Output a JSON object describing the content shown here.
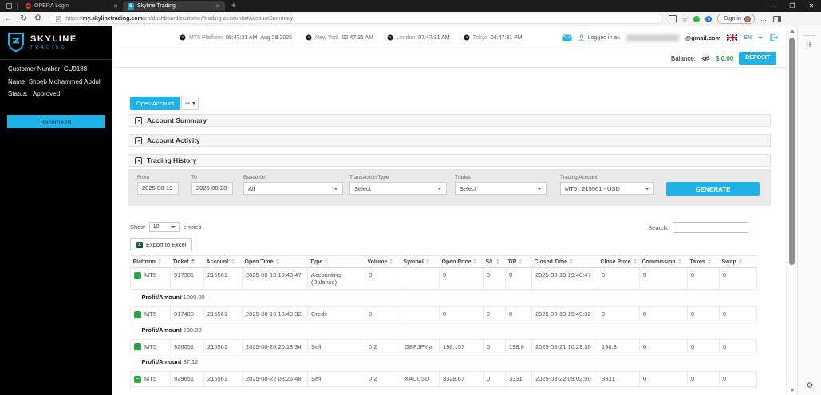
{
  "browser": {
    "tabs": [
      {
        "title": "OPERA Login",
        "active": false
      },
      {
        "title": "Skyline Trading",
        "active": true
      }
    ],
    "url_protocol": "https://",
    "url_host": "my.skylinetrading.com",
    "url_path": "/en/dashboard/customer/trading-accounts#AccountSummary",
    "sign_in_label": "Sign in"
  },
  "sidebar": {
    "logo_title": "SKYLINE",
    "logo_subtitle": "TRADING",
    "customer_number_label": "Customer Number:",
    "customer_number": "CU9188",
    "name_label": "Name:",
    "name": "Shoeb Mohammed Abdul",
    "status_label": "Status:",
    "status": "Approved",
    "become_ib_label": "Become IB"
  },
  "header": {
    "clocks": [
      {
        "label": "MT5 Platform",
        "time": "09:47:31 AM",
        "date": "Aug 28 2025"
      },
      {
        "label": "New York",
        "time": "02:47:31 AM"
      },
      {
        "label": "London",
        "time": "07:47:31 AM"
      },
      {
        "label": "Tokyo",
        "time": "04:47:31 PM"
      }
    ],
    "logged_in_label": "Logged in as",
    "email_suffix": "@gmail.com",
    "language": "EN"
  },
  "balance": {
    "label": "Balance:",
    "amount": "$ 0.00",
    "deposit_label": "DEPOSIT"
  },
  "toolbar": {
    "open_account_label": "Open Account"
  },
  "accordion": [
    {
      "label": "Account Summary"
    },
    {
      "label": "Account Activity"
    },
    {
      "label": "Trading History"
    }
  ],
  "filters": {
    "from_label": "From",
    "from_value": "2025-08-19",
    "to_label": "To",
    "to_value": "2025-08-28",
    "based_on_label": "Based On",
    "based_on_value": "All",
    "transaction_type_label": "Transaction Type",
    "transaction_type_value": "Select",
    "trades_label": "Trades",
    "trades_value": "Select",
    "trading_account_label": "Trading Account",
    "trading_account_value": "MT5 : 215561 - USD",
    "generate_label": "GENERATE"
  },
  "table_controls": {
    "show_label": "Show",
    "entries_value": "10",
    "entries_label": "entries",
    "export_label": "Export to Excel",
    "search_label": "Search:",
    "search_value": ""
  },
  "table": {
    "columns": [
      "Platform",
      "Ticket",
      "Account",
      "Open Time",
      "Type",
      "Volume",
      "Symbol",
      "Open Price",
      "S/L",
      "T/P",
      "Closed Time",
      "Close Price",
      "Commission",
      "Taxes",
      "Swap"
    ],
    "sort": {
      "column": "Ticket",
      "dir": "asc"
    },
    "rows": [
      {
        "platform": "MT5",
        "ticket": "917381",
        "account": "215561",
        "open_time": "2025-08-19 19:40:47",
        "type": "Accounting (Balance)",
        "volume": "0",
        "symbol": "",
        "open_price": "0",
        "sl": "0",
        "tp": "0",
        "tp_green": false,
        "closed_time": "2025-08-19 19:40:47",
        "close_price": "0",
        "commission": "0",
        "taxes": "0",
        "swap": "0",
        "profit_label": "Profit/Amount",
        "profit_value": "1000.00"
      },
      {
        "platform": "MT5",
        "ticket": "917400",
        "account": "215561",
        "open_time": "2025-08-19 19:49:32",
        "type": "Credit",
        "volume": "0",
        "symbol": "",
        "open_price": "0",
        "sl": "0",
        "tp": "0",
        "tp_green": false,
        "closed_time": "2025-08-19 19:49:32",
        "close_price": "0",
        "commission": "0",
        "taxes": "0",
        "swap": "0",
        "profit_label": "Profit/Amount",
        "profit_value": "200.00"
      },
      {
        "platform": "MT5",
        "ticket": "926051",
        "account": "215561",
        "open_time": "2025-08-20 20:18:34",
        "type": "Sell",
        "volume": "0.2",
        "symbol": "GBPJPY.a",
        "open_price": "198.157",
        "sl": "0",
        "tp": "198.8",
        "tp_green": true,
        "closed_time": "2025-08-21 10:29:30",
        "close_price": "198.8",
        "commission": "0",
        "taxes": "0",
        "swap": "0",
        "profit_label": "Profit/Amount",
        "profit_value": "87.12"
      },
      {
        "platform": "MT5",
        "ticket": "929651",
        "account": "215561",
        "open_time": "2025-08-22 08:26:48",
        "type": "Sell",
        "volume": "0.2",
        "symbol": "XAUUSD",
        "open_price": "3328.67",
        "sl": "0",
        "tp": "3331",
        "tp_green": true,
        "closed_time": "2025-08-22 09:02:50",
        "close_price": "3331",
        "commission": "0",
        "taxes": "0",
        "swap": "0",
        "profit_label": "Profit/Amount",
        "profit_value": null
      }
    ]
  },
  "colors": {
    "accent": "#1db3e8",
    "green": "#28a745",
    "profit_green": "#28a06a",
    "balance_green": "#2e9e4f",
    "sidebar_bg": "#000000"
  },
  "icons": {
    "clock": "filled-circle-clock",
    "envelope": "cyan-envelope",
    "user": "blue-person-outline",
    "logout": "cyan-exit-arrow",
    "eye_hidden": "eye-with-slash",
    "excel": "green-square-x",
    "gear": "⚙",
    "plus": "+"
  }
}
